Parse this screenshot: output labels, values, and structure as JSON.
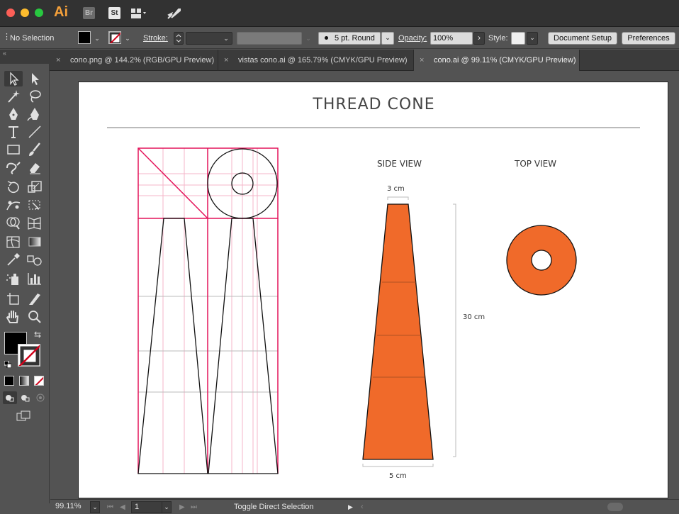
{
  "app": {
    "logo": "Ai",
    "badges": {
      "bridge": "Br",
      "stock": "St"
    }
  },
  "controlbar": {
    "selection": "No Selection",
    "stroke_label": "Stroke:",
    "brush_label": "5 pt. Round",
    "opacity_label": "Opacity:",
    "opacity_value": "100%",
    "style_label": "Style:",
    "document_setup": "Document Setup",
    "preferences": "Preferences",
    "caret": "⌄",
    "arrow": "›"
  },
  "tabs": [
    {
      "close": "×",
      "label": "cono.png @ 144.2% (RGB/GPU Preview)",
      "active": false
    },
    {
      "close": "×",
      "label": "vistas cono.ai @ 165.79% (CMYK/GPU Preview)",
      "active": false
    },
    {
      "close": "×",
      "label": "cono.ai @ 99.11% (CMYK/GPU Preview)",
      "active": true
    }
  ],
  "artboard": {
    "title": "THREAD CONE",
    "side_view": "SIDE VIEW",
    "top_view": "TOP VIEW",
    "top_width": "3 cm",
    "height": "30 cm",
    "bottom_width": "5 cm"
  },
  "colors": {
    "cone_fill": "#f06a2a",
    "guide": "#e4135a",
    "guide_light": "#f4b6c9"
  },
  "status": {
    "zoom": "99.11%",
    "artboard_number": "1",
    "tool_hint": "Toggle Direct Selection"
  }
}
